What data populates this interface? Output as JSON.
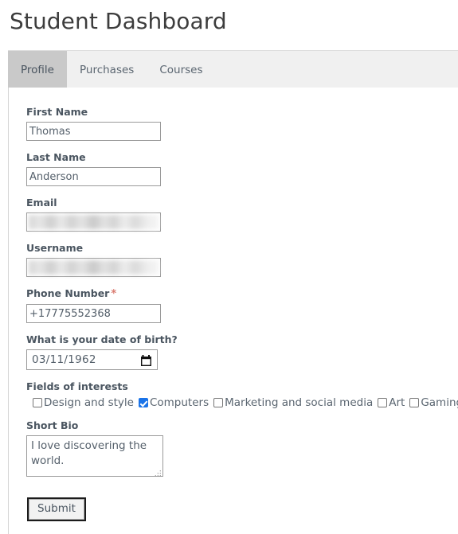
{
  "page": {
    "title": "Student Dashboard"
  },
  "tabs": [
    {
      "label": "Profile",
      "active": true
    },
    {
      "label": "Purchases",
      "active": false
    },
    {
      "label": "Courses",
      "active": false
    }
  ],
  "form": {
    "first_name": {
      "label": "First Name",
      "value": "Thomas",
      "placeholder": ""
    },
    "last_name": {
      "label": "Last Name",
      "value": "Anderson",
      "placeholder": ""
    },
    "email": {
      "label": "Email",
      "value": "",
      "redacted": true,
      "placeholder": ""
    },
    "username": {
      "label": "Username",
      "value": "",
      "redacted": true,
      "placeholder": ""
    },
    "phone": {
      "label": "Phone Number",
      "required_marker": "*",
      "value": "+17775552368",
      "placeholder": ""
    },
    "dob": {
      "label": "What is your date of birth?",
      "value": "03/11/1962",
      "icon": "calendar-icon"
    },
    "interests": {
      "label": "Fields of interests",
      "options": [
        {
          "label": "Design and style",
          "checked": false
        },
        {
          "label": "Computers",
          "checked": true
        },
        {
          "label": "Marketing and social media",
          "checked": false
        },
        {
          "label": "Art",
          "checked": false
        },
        {
          "label": "Gaming",
          "checked": false
        }
      ]
    },
    "short_bio": {
      "label": "Short Bio",
      "value": "I love discovering the world.",
      "placeholder": ""
    },
    "submit": {
      "label": "Submit"
    }
  },
  "colors": {
    "accent_checkbox": "#1a73e8",
    "required_star": "#d9796e",
    "tab_active_bg": "#c9c9c9",
    "tab_bar_bg": "#f0f0f0",
    "label_text": "#4a5560"
  }
}
